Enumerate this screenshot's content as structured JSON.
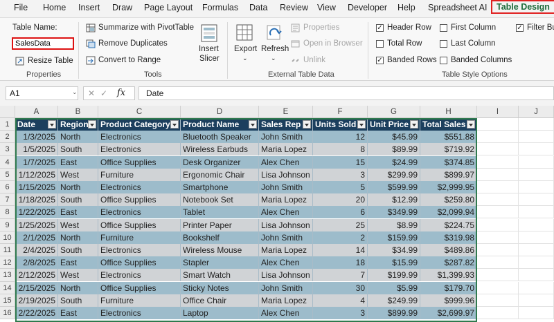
{
  "menu": [
    "File",
    "Home",
    "Insert",
    "Draw",
    "Page Layout",
    "Formulas",
    "Data",
    "Review",
    "View",
    "Developer",
    "Help",
    "Spreadsheet AI",
    "Table Design"
  ],
  "ribbon": {
    "table_name_label": "Table Name:",
    "table_name_value": "SalesData",
    "resize_table": "Resize Table",
    "properties_group": "Properties",
    "summarize_pivot": "Summarize with PivotTable",
    "remove_duplicates": "Remove Duplicates",
    "convert_to_range": "Convert to Range",
    "tools_group": "Tools",
    "insert_slicer_1": "Insert",
    "insert_slicer_2": "Slicer",
    "export": "Export",
    "refresh": "Refresh",
    "properties_btn": "Properties",
    "open_in_browser": "Open in Browser",
    "unlink": "Unlink",
    "external_group": "External Table Data",
    "header_row": "Header Row",
    "total_row": "Total Row",
    "banded_rows": "Banded Rows",
    "first_column": "First Column",
    "last_column": "Last Column",
    "banded_columns": "Banded Columns",
    "filter_button": "Filter Bu",
    "style_options_group": "Table Style Options"
  },
  "formula_bar": {
    "name_box": "A1",
    "fx": "fx",
    "content": "Date"
  },
  "columns": [
    "A",
    "B",
    "C",
    "D",
    "E",
    "F",
    "G",
    "H",
    "I",
    "J"
  ],
  "table": {
    "headers": [
      "Date",
      "Region",
      "Product Category",
      "Product Name",
      "Sales Rep",
      "Units Sold",
      "Unit Price",
      "Total Sales"
    ],
    "rows": [
      [
        "1/3/2025",
        "North",
        "Electronics",
        "Bluetooth Speaker",
        "John Smith",
        "12",
        "$45.99",
        "$551.88"
      ],
      [
        "1/5/2025",
        "South",
        "Electronics",
        "Wireless Earbuds",
        "Maria Lopez",
        "8",
        "$89.99",
        "$719.92"
      ],
      [
        "1/7/2025",
        "East",
        "Office Supplies",
        "Desk Organizer",
        "Alex Chen",
        "15",
        "$24.99",
        "$374.85"
      ],
      [
        "1/12/2025",
        "West",
        "Furniture",
        "Ergonomic Chair",
        "Lisa Johnson",
        "3",
        "$299.99",
        "$899.97"
      ],
      [
        "1/15/2025",
        "North",
        "Electronics",
        "Smartphone",
        "John Smith",
        "5",
        "$599.99",
        "$2,999.95"
      ],
      [
        "1/18/2025",
        "South",
        "Office Supplies",
        "Notebook Set",
        "Maria Lopez",
        "20",
        "$12.99",
        "$259.80"
      ],
      [
        "1/22/2025",
        "East",
        "Electronics",
        "Tablet",
        "Alex Chen",
        "6",
        "$349.99",
        "$2,099.94"
      ],
      [
        "1/25/2025",
        "West",
        "Office Supplies",
        "Printer Paper",
        "Lisa Johnson",
        "25",
        "$8.99",
        "$224.75"
      ],
      [
        "2/1/2025",
        "North",
        "Furniture",
        "Bookshelf",
        "John Smith",
        "2",
        "$159.99",
        "$319.98"
      ],
      [
        "2/4/2025",
        "South",
        "Electronics",
        "Wireless Mouse",
        "Maria Lopez",
        "14",
        "$34.99",
        "$489.86"
      ],
      [
        "2/8/2025",
        "East",
        "Office Supplies",
        "Stapler",
        "Alex Chen",
        "18",
        "$15.99",
        "$287.82"
      ],
      [
        "2/12/2025",
        "West",
        "Electronics",
        "Smart Watch",
        "Lisa Johnson",
        "7",
        "$199.99",
        "$1,399.93"
      ],
      [
        "2/15/2025",
        "North",
        "Office Supplies",
        "Sticky Notes",
        "John Smith",
        "30",
        "$5.99",
        "$179.70"
      ],
      [
        "2/19/2025",
        "South",
        "Furniture",
        "Office Chair",
        "Maria Lopez",
        "4",
        "$249.99",
        "$999.96"
      ],
      [
        "2/22/2025",
        "East",
        "Electronics",
        "Laptop",
        "Alex Chen",
        "3",
        "$899.99",
        "$2,699.97"
      ]
    ]
  },
  "colors": {
    "header": "#1c3f5e",
    "band_dark": "#9dbccb",
    "band_light": "#d0d3d6",
    "accent": "#1d6b3a"
  }
}
